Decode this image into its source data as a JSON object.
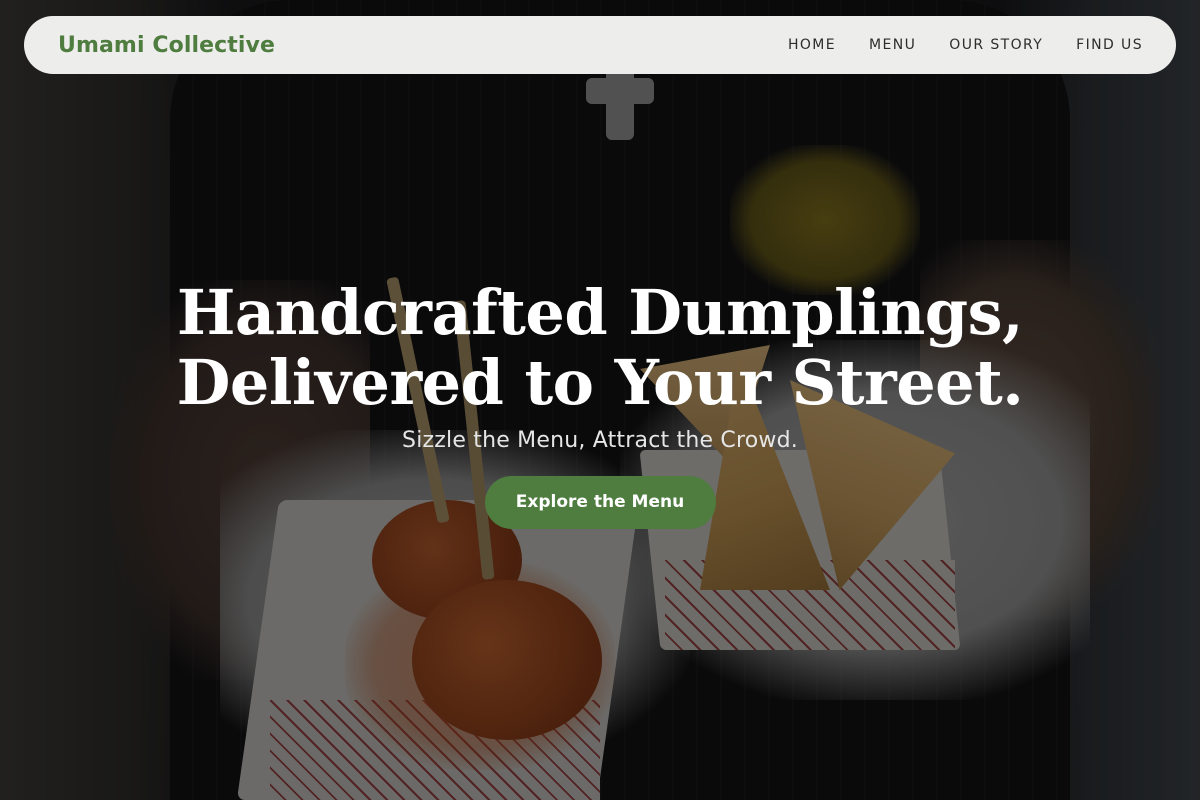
{
  "nav": {
    "brand": "Umami Collective",
    "links": [
      "HOME",
      "MENU",
      "OUR STORY",
      "FIND US"
    ]
  },
  "hero": {
    "headline_line1": "Handcrafted Dumplings,",
    "headline_line2": "Delivered to Your Street.",
    "subheading": "Sizzle the Menu, Attract the Crowd.",
    "cta_label": "Explore the Menu"
  },
  "colors": {
    "brand_green": "#4f7c3f",
    "nav_background": "#ededeb",
    "headline_text": "#ffffff"
  }
}
